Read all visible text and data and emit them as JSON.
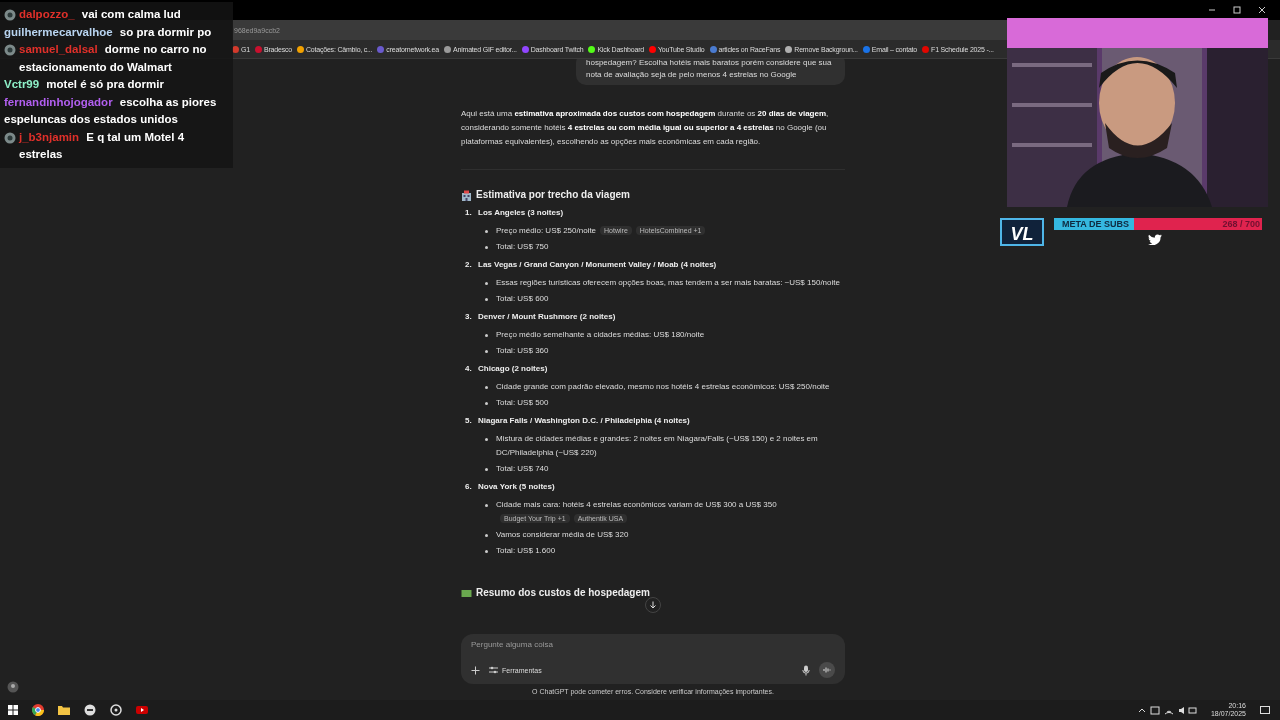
{
  "browser": {
    "address_fragment": "968ed9a9ccb2",
    "bookmarks": [
      {
        "label": "G1",
        "color": "#d33a2c"
      },
      {
        "label": "Bradesco",
        "color": "#c8102e"
      },
      {
        "label": "Cotações: Câmbio, c...",
        "color": "#f2a100"
      },
      {
        "label": "creatornetwork.ea",
        "color": "#6a5acd"
      },
      {
        "label": "Animated GIF editor...",
        "color": "#9a9a9a"
      },
      {
        "label": "Dashboard Twitch",
        "color": "#9146ff"
      },
      {
        "label": "Kick Dashboard",
        "color": "#53fc18"
      },
      {
        "label": "YouTube Studio",
        "color": "#ff0000"
      },
      {
        "label": "articles on RaceFans",
        "color": "#4a7bd0"
      },
      {
        "label": "Remove Backgroun...",
        "color": "#b0b0b0"
      },
      {
        "label": "Email – contato",
        "color": "#1a73e8"
      },
      {
        "label": "F1 Schedule 2025 -...",
        "color": "#e10600"
      }
    ]
  },
  "conversation": {
    "user_message": "hospedagem? Escolha hotéis mais baratos porém considere que sua nota de avaliação seja de pelo menos 4 estrelas no Google",
    "intro": "Aqui está uma **estimativa aproximada dos custos com hospedagem** durante os **20 dias de viagem**, considerando somente hotéis **4 estrelas ou com média igual ou superior a 4 estrelas** no Google (ou plataformas equivalentes), escolhendo as opções mais econômicas em cada região.",
    "heading": "Estimativa por trecho da viagem",
    "sections": [
      {
        "number": "1.",
        "title": "Los Angeles (3 noites)",
        "bullets": [
          {
            "text": "Preço médio: US$ 250/noite",
            "sources": [
              "Hotwire",
              "HotelsCombined +1"
            ]
          },
          {
            "text": "Total: US$ 750"
          }
        ]
      },
      {
        "number": "2.",
        "title": "Las Vegas / Grand Canyon / Monument Valley / Moab (4 noites)",
        "bullets": [
          {
            "text": "Essas regiões turísticas oferecem opções boas, mas tendem a ser mais baratas: ~US$ 150/noite"
          },
          {
            "text": "Total: US$ 600"
          }
        ]
      },
      {
        "number": "3.",
        "title": "Denver / Mount Rushmore (2 noites)",
        "bullets": [
          {
            "text": "Preço médio semelhante a cidades médias: US$ 180/noite"
          },
          {
            "text": "Total: US$ 360"
          }
        ]
      },
      {
        "number": "4.",
        "title": "Chicago (2 noites)",
        "bullets": [
          {
            "text": "Cidade grande com padrão elevado, mesmo nos hotéis 4 estrelas econômicos: US$ 250/noite"
          },
          {
            "text": "Total: US$ 500"
          }
        ]
      },
      {
        "number": "5.",
        "title": "Niagara Falls / Washington D.C. / Philadelphia (4 noites)",
        "bullets": [
          {
            "text": "Mistura de cidades médias e grandes: 2 noites em Niagara/Falls (~US$ 150) e 2 noites em DC/Philadelphia (~US$ 220)"
          },
          {
            "text": "Total: US$ 740"
          }
        ]
      },
      {
        "number": "6.",
        "title": "Nova York (5 noites)",
        "bullets": [
          {
            "text": "Cidade mais cara: hotéis 4 estrelas econômicos variam de US$ 300 a US$ 350",
            "sources": [
              "Budget Your Trip +1",
              "Authentik USA"
            ]
          },
          {
            "text": "Vamos considerar média de US$ 320"
          },
          {
            "text": "Total: US$ 1.600"
          }
        ]
      }
    ],
    "next_heading": "Resumo dos custos de hospedagem"
  },
  "composer": {
    "placeholder": "Pergunte alguma coisa",
    "tools": "Ferramentas",
    "disclaimer": "O ChatGPT pode cometer erros. Considere verificar informações importantes."
  },
  "stream_chat": [
    {
      "user": "dalpozzo_",
      "color": "#e0302a",
      "badge": true,
      "message": "vai com calma lud"
    },
    {
      "user": "guilhermecarvalhoe",
      "color": "#b8d4f0",
      "badge": false,
      "message": "so pra dormir po"
    },
    {
      "user": "samuel_dalsal",
      "color": "#e0302a",
      "badge": true,
      "message": "dorme no carro no estacionamento do Walmart"
    },
    {
      "user": "Vctr99",
      "color": "#8ef0c8",
      "badge": false,
      "message": "motel é só pra dormir"
    },
    {
      "user": "fernandinhojogador",
      "color": "#b25ff0",
      "badge": false,
      "message": "escolha as piores espeluncas dos estados unidos"
    },
    {
      "user": "j_b3njamin",
      "color": "#e0302a",
      "badge": true,
      "message": "E q tal um Motel 4 estrelas"
    }
  ],
  "subs_goal": {
    "logo": "VL",
    "label": "META DE SUBS",
    "count": "268 / 700",
    "level": 0.383
  },
  "taskbar": {
    "time": "20:16",
    "date": "18/07/2025"
  }
}
